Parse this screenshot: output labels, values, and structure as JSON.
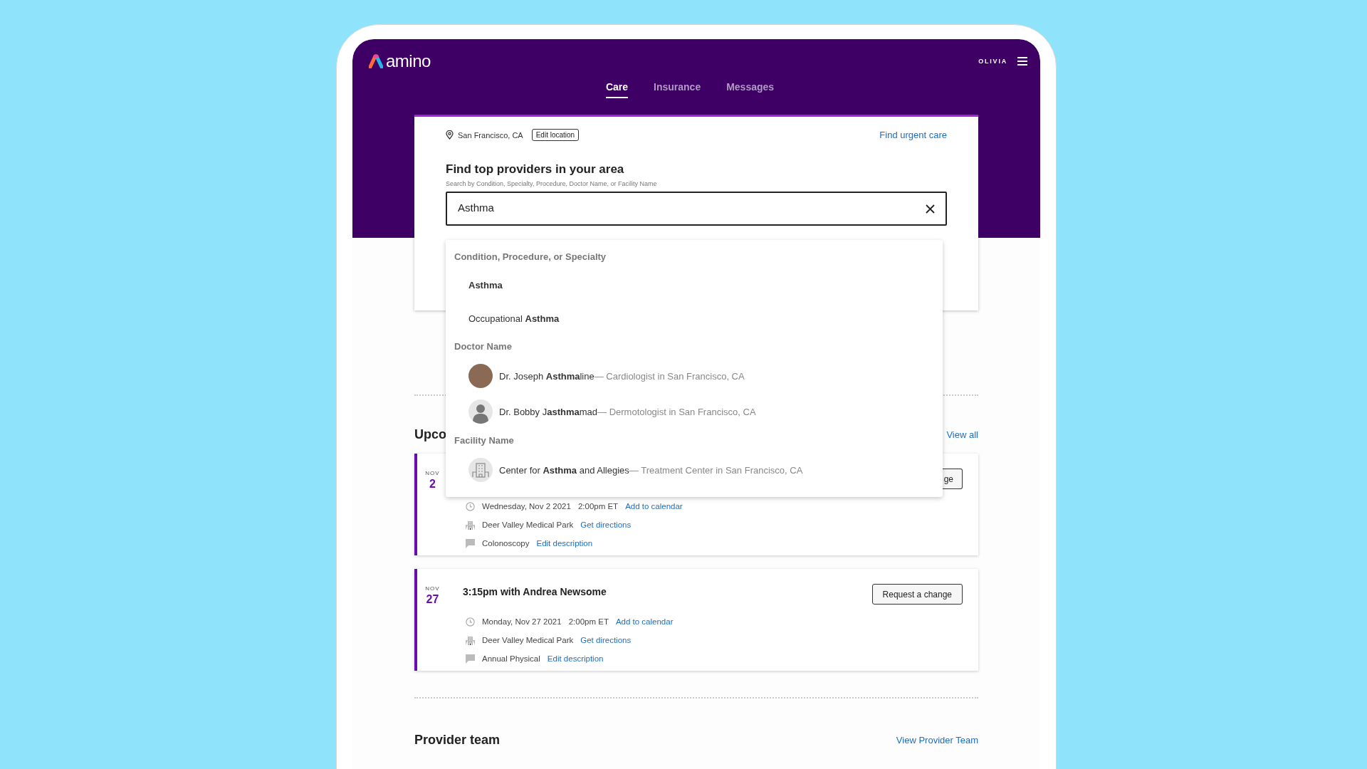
{
  "header": {
    "logo": "amino",
    "user": "OLIVIA",
    "tabs": [
      {
        "label": "Care",
        "selected": true
      },
      {
        "label": "Insurance",
        "selected": false
      },
      {
        "label": "Messages",
        "selected": false
      }
    ]
  },
  "search_card": {
    "location": "San Francisco, CA",
    "edit_location": "Edit location",
    "urgent_link": "Find urgent care",
    "title": "Find top providers in your area",
    "subtitle": "Search by Condition, Specialty, Procedure, Doctor Name, or Facility Name",
    "value": "Asthma"
  },
  "suggestions": [
    {
      "heading": "Condition, Procedure, or Specialty",
      "items": [
        {
          "kind": "text",
          "label": "**Asthma**"
        },
        {
          "kind": "text",
          "label": "Occupational **Asthma**"
        }
      ]
    },
    {
      "heading": "Doctor Name",
      "items": [
        {
          "kind": "photo",
          "label": "Dr. Joseph **Asthma**line",
          "detail": "— Cardiologist in San Francisco, CA"
        },
        {
          "kind": "silhouette",
          "label": "Dr. Bobby J**asthma**mad",
          "detail": "— Dermotologist in San Francisco, CA"
        }
      ]
    },
    {
      "heading": "Facility Name",
      "items": [
        {
          "kind": "facility",
          "label": "Center for **Asthma** and Allegies",
          "detail": "— Treatment Center in San Francisco, CA"
        }
      ]
    }
  ],
  "upcoming": {
    "heading": "Upco",
    "view_all": "View all",
    "appointments": [
      {
        "month": "NOV",
        "day": "2",
        "button": "ge",
        "clipped": true,
        "rows": [
          {
            "kind": "clock",
            "text": "Wednesday, Nov 2 2021",
            "extra": "2:00pm ET",
            "link": "Add to calendar"
          },
          {
            "kind": "building",
            "text": "Deer Valley Medical Park",
            "link": "Get directions"
          },
          {
            "kind": "comment",
            "text": "Colonoscopy",
            "link": "Edit description"
          }
        ]
      },
      {
        "month": "NOV",
        "day": "27",
        "title": "3:15pm with Andrea Newsome",
        "button": "Request a change",
        "clipped": false,
        "rows": [
          {
            "kind": "clock",
            "text": "Monday, Nov 27 2021",
            "extra": "2:00pm ET",
            "link": "Add to calendar"
          },
          {
            "kind": "building",
            "text": "Deer Valley Medical Park",
            "link": "Get directions"
          },
          {
            "kind": "comment",
            "text": "Annual Physical",
            "link": "Edit description"
          }
        ]
      }
    ]
  },
  "provider_team": {
    "heading": "Provider team",
    "link": "View Provider Team"
  }
}
